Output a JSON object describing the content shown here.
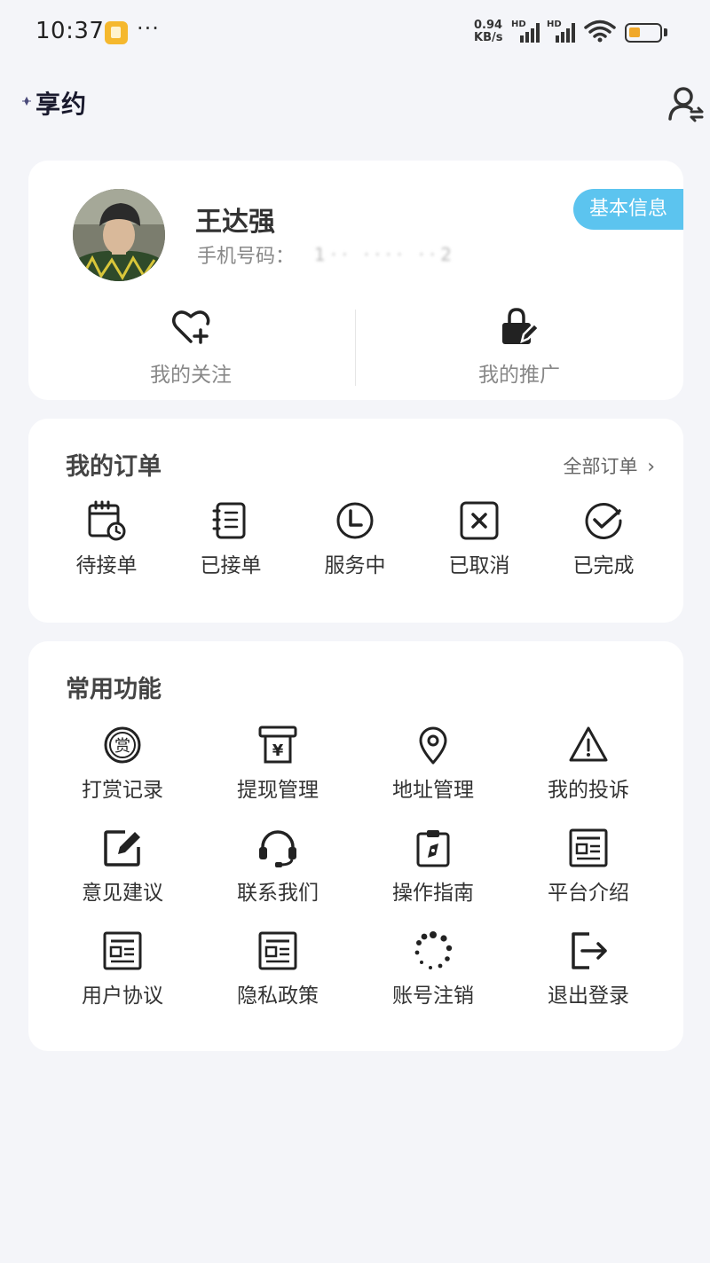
{
  "status_bar": {
    "time": "10:37",
    "dots": "···",
    "net_speed_value": "0.94",
    "net_speed_unit": "KB/s",
    "signal_label": "HD",
    "battery_color": "#f0a82a"
  },
  "header": {
    "logo_text": "享约",
    "logo_colors": [
      "#6b5bd2",
      "#b39be8"
    ]
  },
  "profile": {
    "name": "王达强",
    "phone_label": "手机号码：",
    "phone_value": "1·· ···· ··2",
    "info_button": "基本信息",
    "info_button_color": "#5cc4ef",
    "quick_actions": [
      {
        "label": "我的关注",
        "icon": "heart-plus-icon"
      },
      {
        "label": "我的推广",
        "icon": "lock-edit-icon"
      }
    ]
  },
  "orders": {
    "title": "我的订单",
    "all_link": "全部订单",
    "items": [
      {
        "label": "待接单",
        "icon": "calendar-clock-icon"
      },
      {
        "label": "已接单",
        "icon": "notebook-icon"
      },
      {
        "label": "服务中",
        "icon": "clock-icon"
      },
      {
        "label": "已取消",
        "icon": "cancel-box-icon"
      },
      {
        "label": "已完成",
        "icon": "check-circle-icon"
      }
    ]
  },
  "functions": {
    "title": "常用功能",
    "items": [
      {
        "label": "打赏记录",
        "icon": "reward-icon",
        "glyph": "赏"
      },
      {
        "label": "提现管理",
        "icon": "withdraw-icon",
        "glyph": "¥"
      },
      {
        "label": "地址管理",
        "icon": "location-pin-icon"
      },
      {
        "label": "我的投诉",
        "icon": "warning-icon"
      },
      {
        "label": "意见建议",
        "icon": "edit-square-icon"
      },
      {
        "label": "联系我们",
        "icon": "headset-icon"
      },
      {
        "label": "操作指南",
        "icon": "clipboard-compass-icon"
      },
      {
        "label": "平台介绍",
        "icon": "document-layout-icon"
      },
      {
        "label": "用户协议",
        "icon": "document-layout-icon"
      },
      {
        "label": "隐私政策",
        "icon": "document-layout-icon"
      },
      {
        "label": "账号注销",
        "icon": "loading-icon"
      },
      {
        "label": "退出登录",
        "icon": "logout-icon"
      }
    ]
  }
}
